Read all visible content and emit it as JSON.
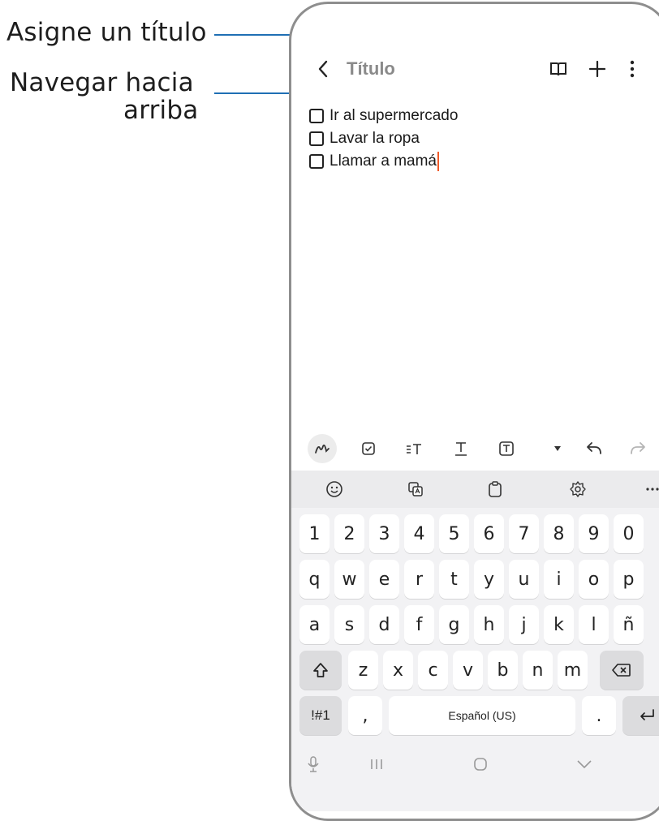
{
  "callouts": {
    "title_label": "Asigne un título",
    "nav_label_line1": "Navegar hacia",
    "nav_label_line2": "arriba"
  },
  "appbar": {
    "title": "Título",
    "icons": [
      "chevron-left-icon",
      "book-icon",
      "plus-icon",
      "more-vert-icon"
    ]
  },
  "note": {
    "items": [
      {
        "text": "Ir al supermercado",
        "checked": false
      },
      {
        "text": "Lavar la ropa",
        "checked": false
      },
      {
        "text": "Llamar a mamá",
        "checked": false
      }
    ]
  },
  "editor_toolbar": {
    "icons": [
      "pen-icon",
      "checkbox-icon",
      "text-format-icon",
      "underline-icon",
      "text-box-icon",
      "dropdown-arrow-icon",
      "undo-icon",
      "redo-icon"
    ]
  },
  "keyboard": {
    "tools": [
      "emoji-icon",
      "translate-icon",
      "clipboard-icon",
      "settings-icon",
      "more-icon"
    ],
    "row1": [
      "1",
      "2",
      "3",
      "4",
      "5",
      "6",
      "7",
      "8",
      "9",
      "0"
    ],
    "row2": [
      "q",
      "w",
      "e",
      "r",
      "t",
      "y",
      "u",
      "i",
      "o",
      "p"
    ],
    "row3": [
      "a",
      "s",
      "d",
      "f",
      "g",
      "h",
      "j",
      "k",
      "l",
      "ñ"
    ],
    "row4": [
      "z",
      "x",
      "c",
      "v",
      "b",
      "n",
      "m"
    ],
    "symbols_key": "!#1",
    "comma_key": ",",
    "space_label": "Español (US)",
    "period_key": ".",
    "colors": {
      "key_bg": "#ffffff",
      "special_bg": "#dcdcde",
      "board_bg": "#f2f2f4"
    }
  },
  "navbar": {
    "icons": [
      "mic-icon",
      "recents-icon",
      "home-icon",
      "hide-keyboard-icon"
    ]
  },
  "accent": "#1f6fb4",
  "caret_color": "#f05a28"
}
